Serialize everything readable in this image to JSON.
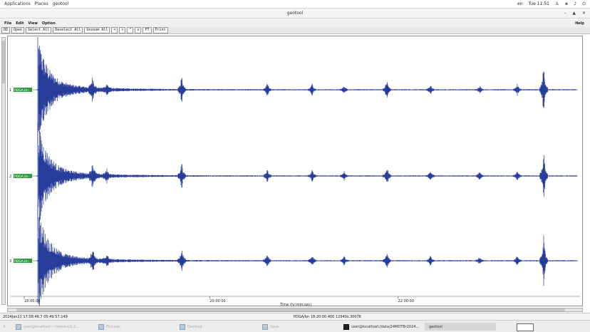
{
  "system_bar": {
    "applications": "Applications",
    "places": "Places",
    "app": "geotool",
    "lang": "en",
    "clock": "Tue 11:51"
  },
  "window": {
    "title": "geotool"
  },
  "menu": {
    "file": "File",
    "edit": "Edit",
    "view": "View",
    "option": "Option",
    "help": "Help"
  },
  "toolbar": {
    "dd": "DD",
    "open": "Open",
    "select_all": "Select All",
    "deselect_all": "Deselect All",
    "unzoom_all": "Unzoom All",
    "lt": "<",
    "gt": ">",
    "up": "^",
    "down": "v",
    "ff": "FT",
    "print": "Print"
  },
  "plot": {
    "traces": [
      {
        "index": "1",
        "label": "PDGA.bn"
      },
      {
        "index": "2",
        "label": "PDGA.bn"
      },
      {
        "index": "3",
        "label": "PDGA.bn"
      }
    ],
    "x_ticks": [
      {
        "label": "18:00:00",
        "t": 0.0
      },
      {
        "label": "20:00:00",
        "t": 0.3398
      },
      {
        "label": "22:00:00",
        "t": 0.6848
      }
    ],
    "x_axis_label": "Time (hr:mm:sec)",
    "trace_color": "#283c9c",
    "label_bg": "#2e9a3a"
  },
  "status": {
    "left": "2024Jan22 17:58:46.7     05:49:57.149",
    "right": "PDGA/bn  18:20:00.400  12940s.30076"
  },
  "taskbar": {
    "t1": "user@localhost:~/seismo/1.2...",
    "t2": "Pictures",
    "t3": "Desktop",
    "t4": "Save",
    "t5": "user@localhost:/data/24MDTBr2024...",
    "t6": "geotool"
  }
}
